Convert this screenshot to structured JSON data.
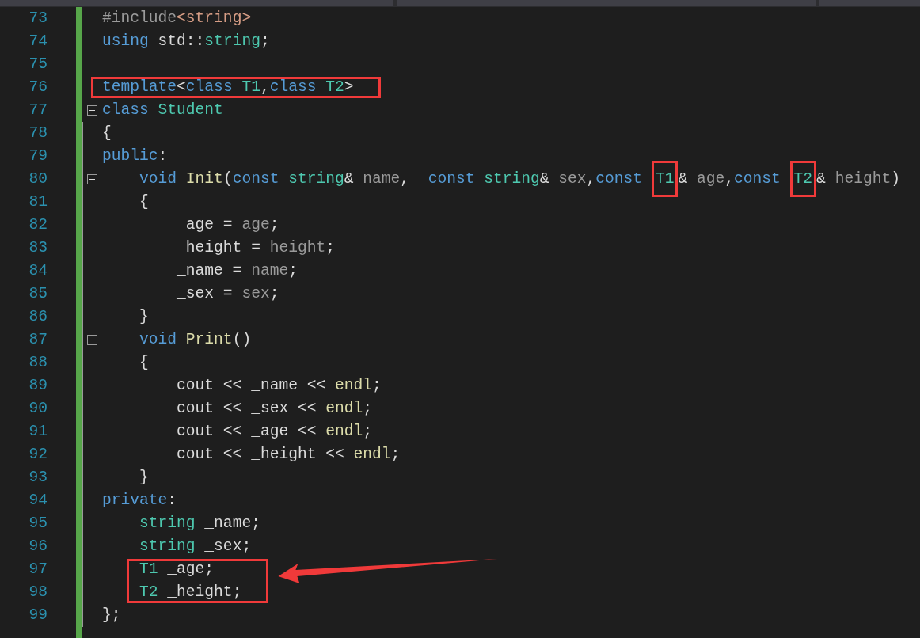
{
  "editor": {
    "lines": [
      {
        "number": "73",
        "tokens": [
          {
            "kind": "preproc",
            "text": "#include"
          },
          {
            "kind": "literal",
            "text": "<string>"
          }
        ]
      },
      {
        "number": "74",
        "tokens": [
          {
            "kind": "keyword",
            "text": "using "
          },
          {
            "kind": "plain",
            "text": "std::"
          },
          {
            "kind": "type",
            "text": "string"
          },
          {
            "kind": "plain",
            "text": ";"
          }
        ]
      },
      {
        "number": "75"
      },
      {
        "number": "76",
        "highlighted": true,
        "tokens": [
          {
            "kind": "keyword",
            "text": "template"
          },
          {
            "kind": "plain",
            "text": "<"
          },
          {
            "kind": "keyword",
            "text": "class "
          },
          {
            "kind": "type",
            "text": "T1"
          },
          {
            "kind": "plain",
            "text": ","
          },
          {
            "kind": "keyword",
            "text": "class "
          },
          {
            "kind": "type",
            "text": "T2"
          },
          {
            "kind": "plain",
            "text": ">"
          }
        ]
      },
      {
        "number": "77",
        "fold_expanded": true,
        "tokens": [
          {
            "kind": "keyword",
            "text": "class "
          },
          {
            "kind": "type",
            "text": "Student"
          }
        ]
      },
      {
        "number": "78",
        "tokens": [
          {
            "kind": "plain",
            "text": "{"
          }
        ]
      },
      {
        "number": "79",
        "tokens": [
          {
            "kind": "keyword",
            "text": "public"
          },
          {
            "kind": "plain",
            "text": ":"
          }
        ]
      },
      {
        "number": "80",
        "fold_expanded": true,
        "tokens": [
          {
            "kind": "keyword",
            "text": "    void "
          },
          {
            "kind": "function",
            "text": "Init"
          },
          {
            "kind": "plain",
            "text": "("
          },
          {
            "kind": "keyword",
            "text": "const "
          },
          {
            "kind": "type",
            "text": "string"
          },
          {
            "kind": "plain",
            "text": "& "
          },
          {
            "kind": "param",
            "text": "name"
          },
          {
            "kind": "plain",
            "text": ",  "
          },
          {
            "kind": "keyword",
            "text": "const "
          },
          {
            "kind": "type",
            "text": "string"
          },
          {
            "kind": "plain",
            "text": "& "
          },
          {
            "kind": "param",
            "text": "sex"
          },
          {
            "kind": "plain",
            "text": ","
          },
          {
            "kind": "keyword",
            "text": "const "
          },
          {
            "kind": "type",
            "text": "T1",
            "highlighted": true
          },
          {
            "kind": "plain",
            "text": "& "
          },
          {
            "kind": "param",
            "text": "age"
          },
          {
            "kind": "plain",
            "text": ","
          },
          {
            "kind": "keyword",
            "text": "const "
          },
          {
            "kind": "type",
            "text": "T2",
            "highlighted": true
          },
          {
            "kind": "plain",
            "text": "& "
          },
          {
            "kind": "param",
            "text": "height"
          },
          {
            "kind": "plain",
            "text": ")"
          }
        ]
      },
      {
        "number": "81",
        "tokens": [
          {
            "kind": "plain",
            "text": "    {"
          }
        ]
      },
      {
        "number": "82",
        "tokens": [
          {
            "kind": "plain",
            "text": "        _age = "
          },
          {
            "kind": "param",
            "text": "age"
          },
          {
            "kind": "plain",
            "text": ";"
          }
        ]
      },
      {
        "number": "83",
        "tokens": [
          {
            "kind": "plain",
            "text": "        _height = "
          },
          {
            "kind": "param",
            "text": "height"
          },
          {
            "kind": "plain",
            "text": ";"
          }
        ]
      },
      {
        "number": "84",
        "tokens": [
          {
            "kind": "plain",
            "text": "        _name = "
          },
          {
            "kind": "param",
            "text": "name"
          },
          {
            "kind": "plain",
            "text": ";"
          }
        ]
      },
      {
        "number": "85",
        "tokens": [
          {
            "kind": "plain",
            "text": "        _sex = "
          },
          {
            "kind": "param",
            "text": "sex"
          },
          {
            "kind": "plain",
            "text": ";"
          }
        ]
      },
      {
        "number": "86",
        "tokens": [
          {
            "kind": "plain",
            "text": "    }"
          }
        ]
      },
      {
        "number": "87",
        "fold_expanded": true,
        "tokens": [
          {
            "kind": "keyword",
            "text": "    void "
          },
          {
            "kind": "function",
            "text": "Print"
          },
          {
            "kind": "plain",
            "text": "()"
          }
        ]
      },
      {
        "number": "88",
        "tokens": [
          {
            "kind": "plain",
            "text": "    {"
          }
        ]
      },
      {
        "number": "89",
        "tokens": [
          {
            "kind": "plain",
            "text": "        cout << _name << "
          },
          {
            "kind": "function",
            "text": "endl"
          },
          {
            "kind": "plain",
            "text": ";"
          }
        ]
      },
      {
        "number": "90",
        "tokens": [
          {
            "kind": "plain",
            "text": "        cout << _sex << "
          },
          {
            "kind": "function",
            "text": "endl"
          },
          {
            "kind": "plain",
            "text": ";"
          }
        ]
      },
      {
        "number": "91",
        "tokens": [
          {
            "kind": "plain",
            "text": "        cout << _age << "
          },
          {
            "kind": "function",
            "text": "endl"
          },
          {
            "kind": "plain",
            "text": ";"
          }
        ]
      },
      {
        "number": "92",
        "tokens": [
          {
            "kind": "plain",
            "text": "        cout << _height << "
          },
          {
            "kind": "function",
            "text": "endl"
          },
          {
            "kind": "plain",
            "text": ";"
          }
        ]
      },
      {
        "number": "93",
        "tokens": [
          {
            "kind": "plain",
            "text": "    }"
          }
        ]
      },
      {
        "number": "94",
        "tokens": [
          {
            "kind": "keyword",
            "text": "private"
          },
          {
            "kind": "plain",
            "text": ":"
          }
        ]
      },
      {
        "number": "95",
        "tokens": [
          {
            "kind": "type",
            "text": "    string"
          },
          {
            "kind": "plain",
            "text": " _name;"
          }
        ]
      },
      {
        "number": "96",
        "tokens": [
          {
            "kind": "type",
            "text": "    string"
          },
          {
            "kind": "plain",
            "text": " _sex;"
          }
        ]
      },
      {
        "number": "97",
        "highlighted": true,
        "tokens": [
          {
            "kind": "type",
            "text": "    T1"
          },
          {
            "kind": "plain",
            "text": " _age;"
          }
        ]
      },
      {
        "number": "98",
        "highlighted": true,
        "tokens": [
          {
            "kind": "type",
            "text": "    T2"
          },
          {
            "kind": "plain",
            "text": " _height;"
          }
        ]
      },
      {
        "number": "99",
        "tokens": [
          {
            "kind": "plain",
            "text": "};"
          }
        ]
      }
    ]
  }
}
